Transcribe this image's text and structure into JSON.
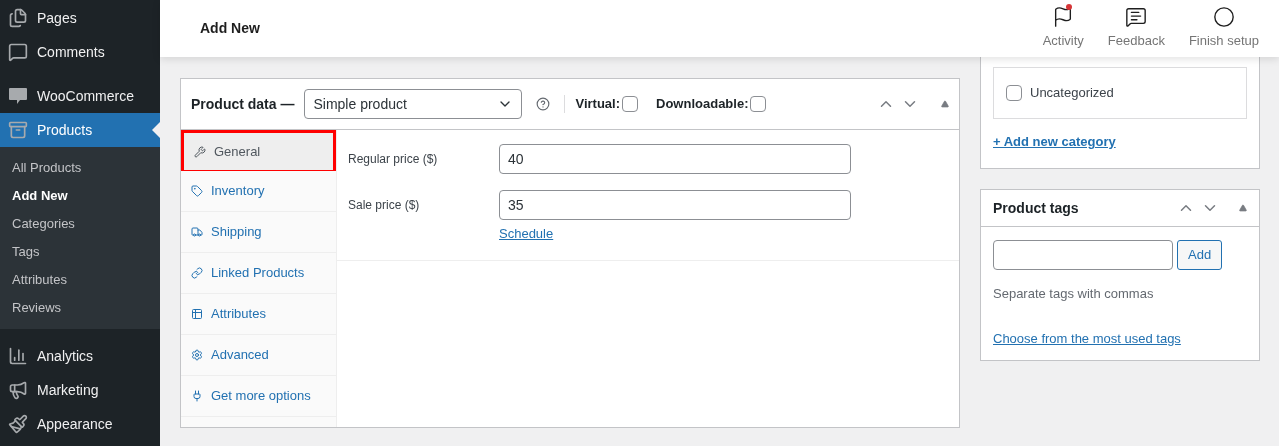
{
  "sidebar": {
    "items": [
      {
        "label": "Pages",
        "selected": false
      },
      {
        "label": "Comments",
        "selected": false
      },
      {
        "label": "WooCommerce",
        "selected": false
      },
      {
        "label": "Products",
        "selected": true,
        "children": [
          {
            "label": "All Products",
            "selected": false
          },
          {
            "label": "Add New",
            "selected": true
          },
          {
            "label": "Categories",
            "selected": false
          },
          {
            "label": "Tags",
            "selected": false
          },
          {
            "label": "Attributes",
            "selected": false
          },
          {
            "label": "Reviews",
            "selected": false
          }
        ]
      },
      {
        "label": "Analytics",
        "selected": false
      },
      {
        "label": "Marketing",
        "selected": false
      },
      {
        "label": "Appearance",
        "selected": false
      }
    ]
  },
  "header": {
    "title": "Add New",
    "actions": [
      {
        "label": "Activity",
        "notification": true
      },
      {
        "label": "Feedback",
        "notification": false
      },
      {
        "label": "Finish setup",
        "notification": false
      }
    ]
  },
  "product_data": {
    "title": "Product data —",
    "type_select": {
      "value": "Simple product"
    },
    "virtual": {
      "label": "Virtual:",
      "checked": false
    },
    "downloadable": {
      "label": "Downloadable:",
      "checked": false
    },
    "tabs": [
      {
        "label": "General",
        "selected": true,
        "highlighted": true
      },
      {
        "label": "Inventory",
        "selected": false,
        "highlighted": false
      },
      {
        "label": "Shipping",
        "selected": false,
        "highlighted": false
      },
      {
        "label": "Linked Products",
        "selected": false,
        "highlighted": false
      },
      {
        "label": "Attributes",
        "selected": false,
        "highlighted": false
      },
      {
        "label": "Advanced",
        "selected": false,
        "highlighted": false
      },
      {
        "label": "Get more options",
        "selected": false,
        "highlighted": false
      }
    ],
    "fields": [
      {
        "label": "Regular price ($)",
        "value": "40"
      },
      {
        "label": "Sale price ($)",
        "value": "35",
        "link": "Schedule"
      }
    ]
  },
  "categories": {
    "items": [
      {
        "label": "Uncategorized",
        "checked": false
      }
    ],
    "add_link": "+ Add new category"
  },
  "product_tags": {
    "title": "Product tags",
    "button": "Add",
    "hint": "Separate tags with commas",
    "link": "Choose from the most used tags"
  }
}
